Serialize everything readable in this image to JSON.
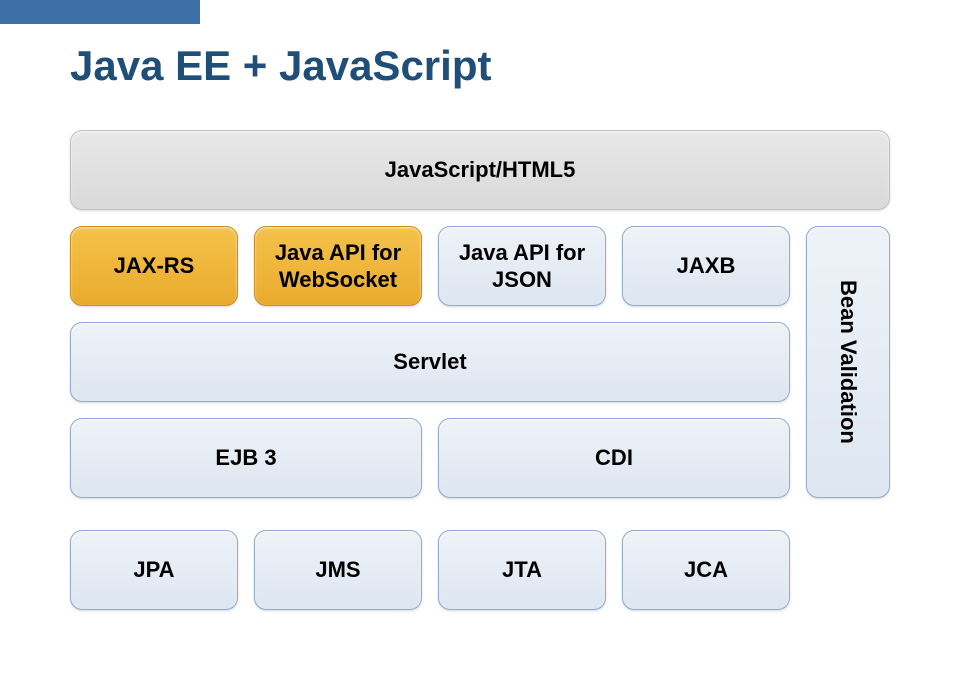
{
  "title": "Java EE + JavaScript",
  "row_top": {
    "label": "JavaScript/HTML5"
  },
  "row_apis": [
    {
      "label": "JAX-RS"
    },
    {
      "label": "Java API for\nWebSocket"
    },
    {
      "label": "Java API for\nJSON"
    },
    {
      "label": "JAXB"
    }
  ],
  "row_mid1": {
    "label": "Servlet"
  },
  "row_mid2": [
    {
      "label": "EJB 3"
    },
    {
      "label": "CDI"
    }
  ],
  "side": {
    "label": "Bean Validation"
  },
  "row_bottom": [
    {
      "label": "JPA"
    },
    {
      "label": "JMS"
    },
    {
      "label": "JTA"
    },
    {
      "label": "JCA"
    }
  ]
}
